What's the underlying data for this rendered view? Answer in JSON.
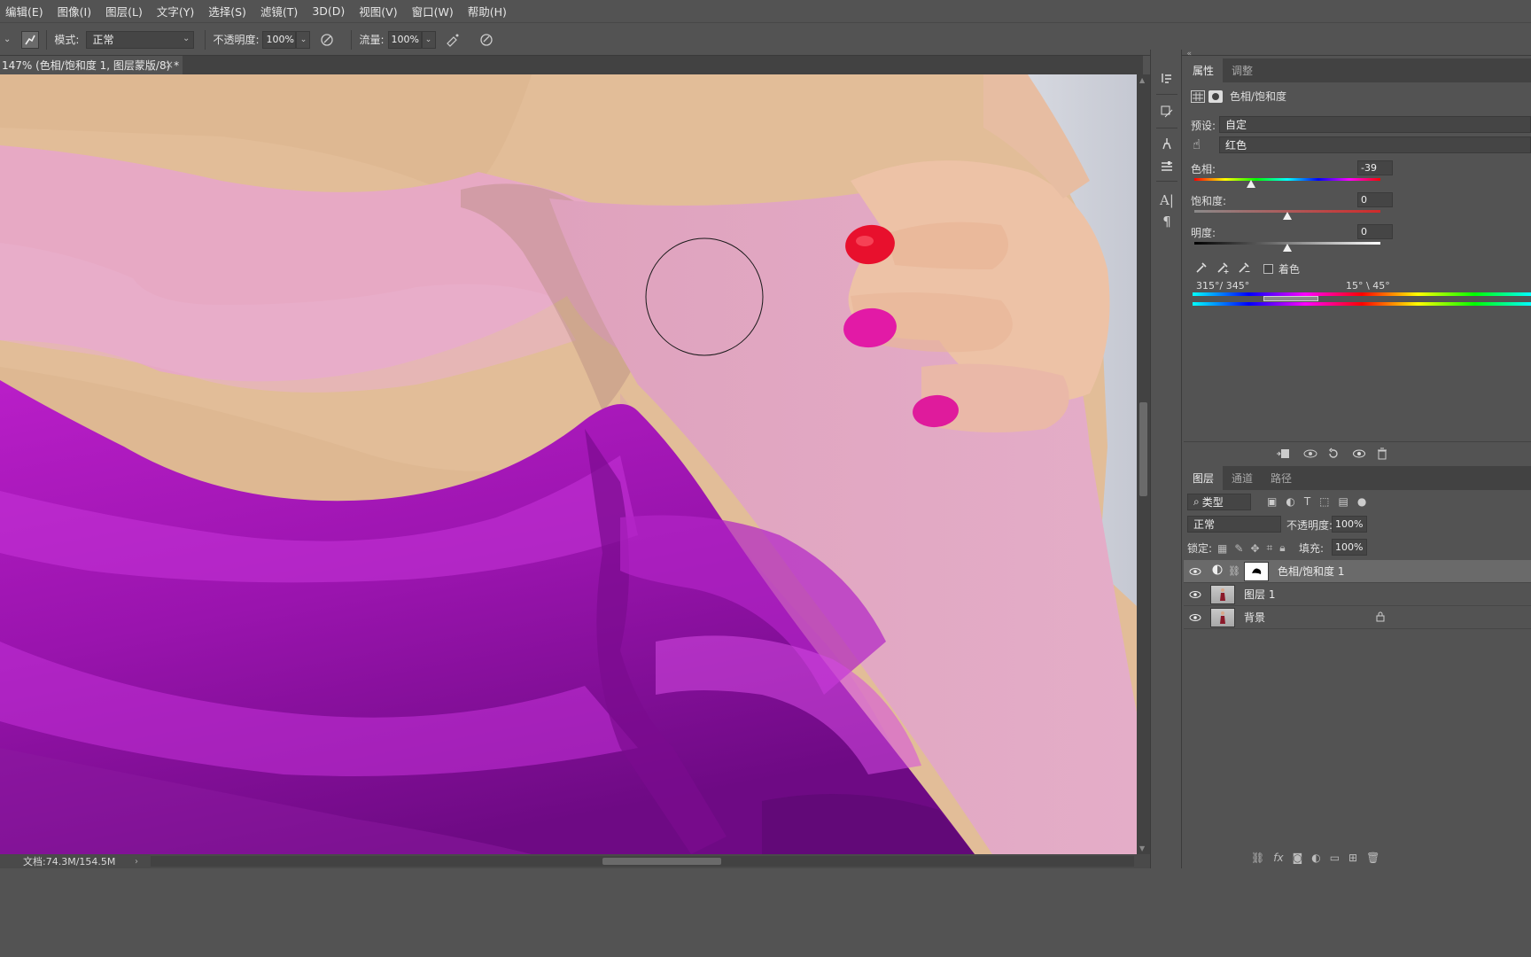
{
  "menu": [
    "编辑(E)",
    "图像(I)",
    "图层(L)",
    "文字(Y)",
    "选择(S)",
    "滤镜(T)",
    "3D(D)",
    "视图(V)",
    "窗口(W)",
    "帮助(H)"
  ],
  "options": {
    "mode_label": "模式:",
    "mode_value": "正常",
    "opacity_label": "不透明度:",
    "opacity_value": "100%",
    "flow_label": "流量:",
    "flow_value": "100%"
  },
  "document": {
    "tab_title": "147% (色相/饱和度 1, 图层蒙版/8) *",
    "close": "×"
  },
  "status": {
    "doc_size": "文档:74.3M/154.5M",
    "arrow": "›"
  },
  "properties": {
    "tabs": [
      "属性",
      "调整"
    ],
    "title": "色相/饱和度",
    "preset_label": "预设:",
    "preset_value": "自定",
    "channel_value": "红色",
    "hue_label": "色相:",
    "hue_value": "-39",
    "hue_fraction": 0.305,
    "saturation_label": "饱和度:",
    "saturation_value": "0",
    "saturation_fraction": 0.5,
    "lightness_label": "明度:",
    "lightness_value": "0",
    "lightness_fraction": 0.5,
    "colorize_label": "着色",
    "range_left": "315°/ 345°",
    "range_right": "15° \\ 45°"
  },
  "layers": {
    "tabs": [
      "图层",
      "通道",
      "路径"
    ],
    "filter_value": "类型",
    "blend_mode": "正常",
    "opacity_label": "不透明度:",
    "opacity_value": "100%",
    "lock_label": "锁定:",
    "fill_label": "填充:",
    "fill_value": "100%",
    "items": [
      {
        "name": "色相/饱和度 1",
        "selected": true
      },
      {
        "name": "图层 1",
        "selected": false
      },
      {
        "name": "背景",
        "selected": false
      }
    ]
  },
  "colors": {
    "chrome": "#535353",
    "skin": "#e4bf9a",
    "mask_pink": "#e7a7c8",
    "satin": "#a316b4"
  }
}
